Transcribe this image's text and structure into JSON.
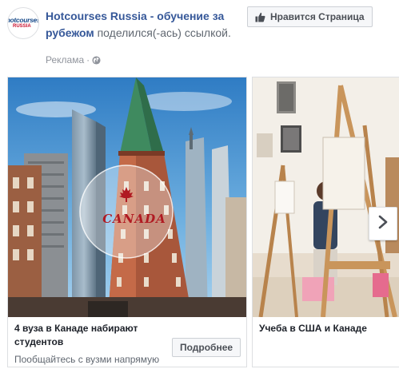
{
  "header": {
    "page_name": "Hotcourses Russia - обучение за рубежом",
    "action_text": " поделился(-ась) ссылкой.",
    "sponsored_label": "Реклама",
    "sponsored_separator": " · ",
    "like_button_label": "Нравится Страница",
    "avatar": {
      "logo_top": "hotcourses",
      "logo_bottom": "RUSSIA"
    }
  },
  "carousel": {
    "cards": [
      {
        "image_overlay_text": "CANADA",
        "title": "4 вуза в Канаде набирают студентов",
        "description": "Пообщайтесь с вузми напрямую",
        "cta_label": "Подробнее"
      },
      {
        "title": "Учеба в США и Канаде"
      }
    ]
  },
  "icons": {
    "like": "thumbs-up-icon",
    "globe": "globe-icon",
    "next": "chevron-right-icon",
    "maple_leaf": "maple-leaf-icon"
  },
  "colors": {
    "page_link": "#365899",
    "secondary_text": "#606770",
    "meta_text": "#90949c",
    "button_bg": "#f6f7f9",
    "button_border": "#ccd0d5",
    "canada_red": "#b01a22"
  }
}
